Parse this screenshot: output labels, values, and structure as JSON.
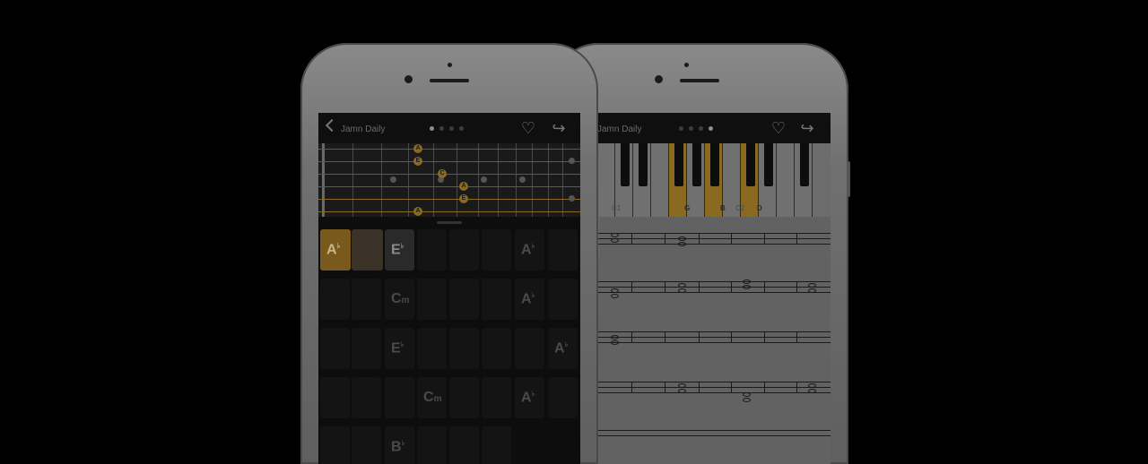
{
  "front_phone": {
    "nav": {
      "title": "Jamn Daily",
      "page_dots": 4,
      "active_dot": 0
    },
    "fretboard_notes": [
      "A",
      "E",
      "C",
      "A",
      "E",
      "A"
    ],
    "chord_cells": [
      {
        "root": "A",
        "acc": "♭",
        "sub": ""
      },
      {
        "root": "E",
        "acc": "♭",
        "sub": ""
      },
      {
        "root": "A",
        "acc": "♭",
        "sub": ""
      },
      {
        "root": "C",
        "acc": "",
        "sub": "m"
      },
      {
        "root": "A",
        "acc": "♭",
        "sub": ""
      },
      {
        "root": "E",
        "acc": "♭",
        "sub": ""
      },
      {
        "root": "A",
        "acc": "♭",
        "sub": ""
      },
      {
        "root": "C",
        "acc": "",
        "sub": "m"
      },
      {
        "root": "A",
        "acc": "♭",
        "sub": ""
      },
      {
        "root": "B",
        "acc": "♭",
        "sub": ""
      }
    ]
  },
  "back_phone": {
    "nav": {
      "title": "Jamn Daily",
      "page_dots": 4,
      "active_dot": 3
    },
    "key_labels": [
      "C1",
      "G",
      "B",
      "C2",
      "D"
    ],
    "highlight_color": "#8a6a20"
  },
  "icons": {
    "back": "chevron-left-icon",
    "favorite": "heart-plus-icon",
    "share": "share-arrow-icon"
  }
}
